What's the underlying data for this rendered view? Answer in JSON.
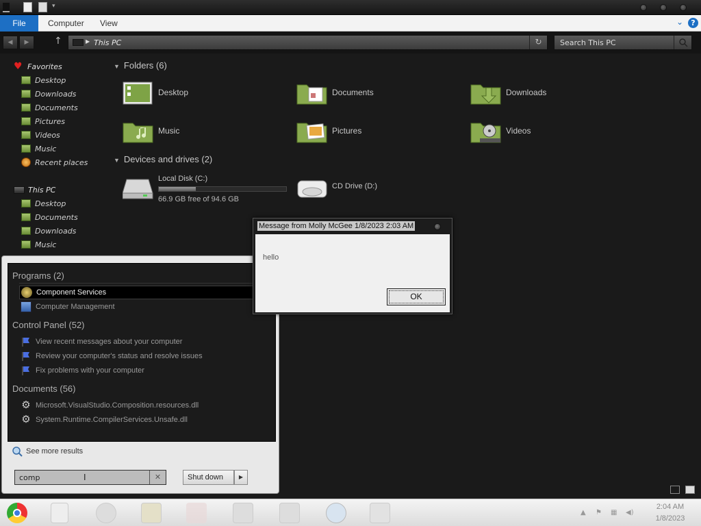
{
  "ribbon": {
    "tabs": [
      {
        "label": "File"
      },
      {
        "label": "Computer"
      },
      {
        "label": "View"
      }
    ],
    "help": "?"
  },
  "address": {
    "path": "This PC",
    "search_placeholder": "Search This PC"
  },
  "navpane": {
    "favorites_label": "Favorites",
    "favorites": [
      "Desktop",
      "Downloads",
      "Documents",
      "Pictures",
      "Videos",
      "Music",
      "Recent places"
    ],
    "thispc_label": "This PC",
    "thispc_items": [
      "Desktop",
      "Documents",
      "Downloads",
      "Music"
    ]
  },
  "content": {
    "folders_header": "Folders (6)",
    "folders": [
      "Desktop",
      "Documents",
      "Downloads",
      "Music",
      "Pictures",
      "Videos"
    ],
    "devices_header": "Devices and drives (2)",
    "drives": [
      {
        "label": "Local Disk (C:)",
        "free": "66.9 GB free of 94.6 GB",
        "used_fraction": 0.293
      },
      {
        "label": "CD Drive (D:)"
      }
    ]
  },
  "startmenu": {
    "categories": [
      {
        "label": "Programs (2)",
        "items": [
          "Component Services",
          "Computer Management"
        ]
      },
      {
        "label": "Control Panel (52)",
        "items": [
          "View recent messages about your computer",
          "Review your computer's status and resolve issues",
          "Fix problems with your computer"
        ]
      },
      {
        "label": "Documents (56)",
        "items": [
          "Microsoft.VisualStudio.Composition.resources.dll",
          "System.Runtime.CompilerServices.Unsafe.dll"
        ]
      }
    ],
    "see_more": "See more results",
    "search_value": "comp",
    "shutdown": "Shut down"
  },
  "dialog": {
    "title": "Message from Molly McGee 1/8/2023 2:03 AM",
    "message": "hello",
    "ok": "OK"
  },
  "taskbar": {
    "time": "2:04 AM",
    "date": "1/8/2023"
  },
  "colors": {
    "accent": "#1d6fc4",
    "folder_green": "#8aab4f"
  }
}
